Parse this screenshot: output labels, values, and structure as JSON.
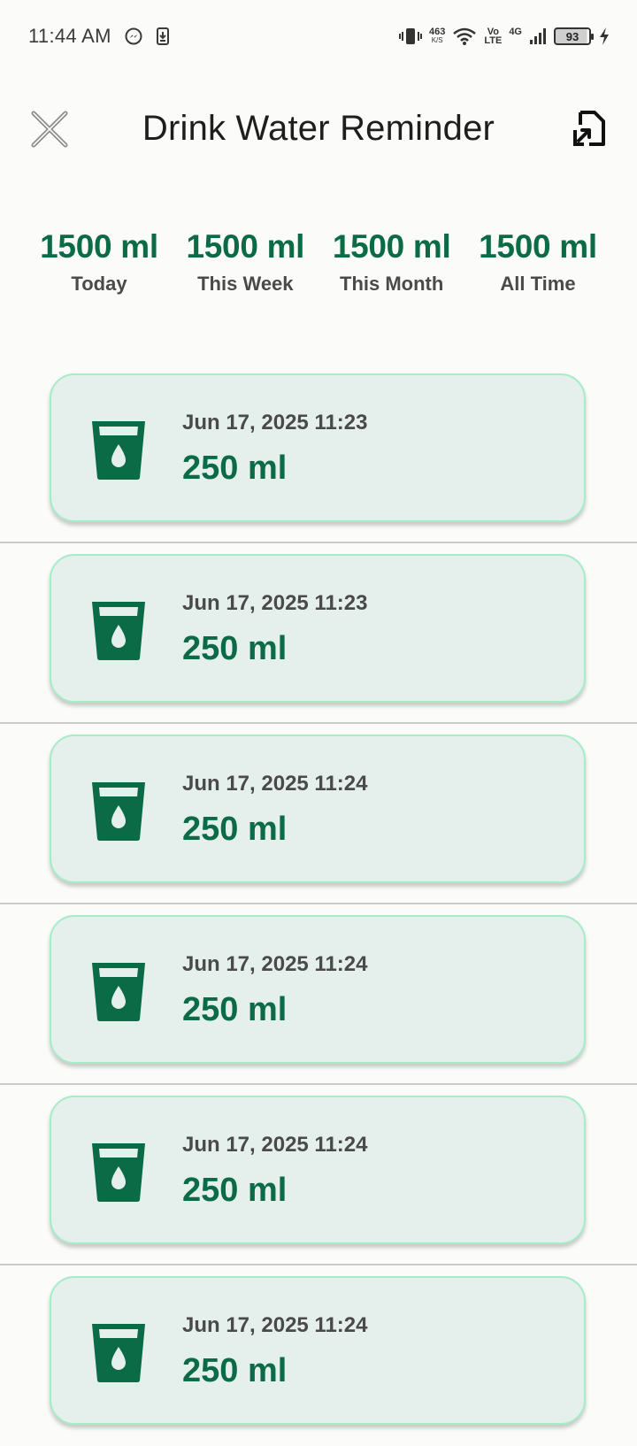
{
  "status_bar": {
    "time": "11:44 AM",
    "net_speed_value": "463",
    "net_speed_unit": "K/S",
    "volte_top": "Vo",
    "volte_bottom": "LTE",
    "network": "4G",
    "battery": "93",
    "icons": [
      "messenger-icon",
      "download-icon",
      "vibrate-icon",
      "wifi-icon",
      "signal-icon",
      "battery-icon",
      "charging-icon"
    ]
  },
  "header": {
    "title": "Drink Water Reminder",
    "close_icon": "close-icon",
    "export_icon": "export-file-icon"
  },
  "stats": [
    {
      "value": "1500 ml",
      "label": "Today"
    },
    {
      "value": "1500 ml",
      "label": "This Week"
    },
    {
      "value": "1500 ml",
      "label": "This Month"
    },
    {
      "value": "1500 ml",
      "label": "All Time"
    }
  ],
  "entries": [
    {
      "date": "Jun 17, 2025 11:23",
      "amount": "250 ml"
    },
    {
      "date": "Jun 17, 2025 11:23",
      "amount": "250 ml"
    },
    {
      "date": "Jun 17, 2025 11:24",
      "amount": "250 ml"
    },
    {
      "date": "Jun 17, 2025 11:24",
      "amount": "250 ml"
    },
    {
      "date": "Jun 17, 2025 11:24",
      "amount": "250 ml"
    },
    {
      "date": "Jun 17, 2025 11:24",
      "amount": "250 ml"
    }
  ],
  "colors": {
    "accent": "#0b6b47",
    "card_bg": "#e5efeb",
    "card_border": "#a6ecc7",
    "background": "#fbfcf9"
  }
}
